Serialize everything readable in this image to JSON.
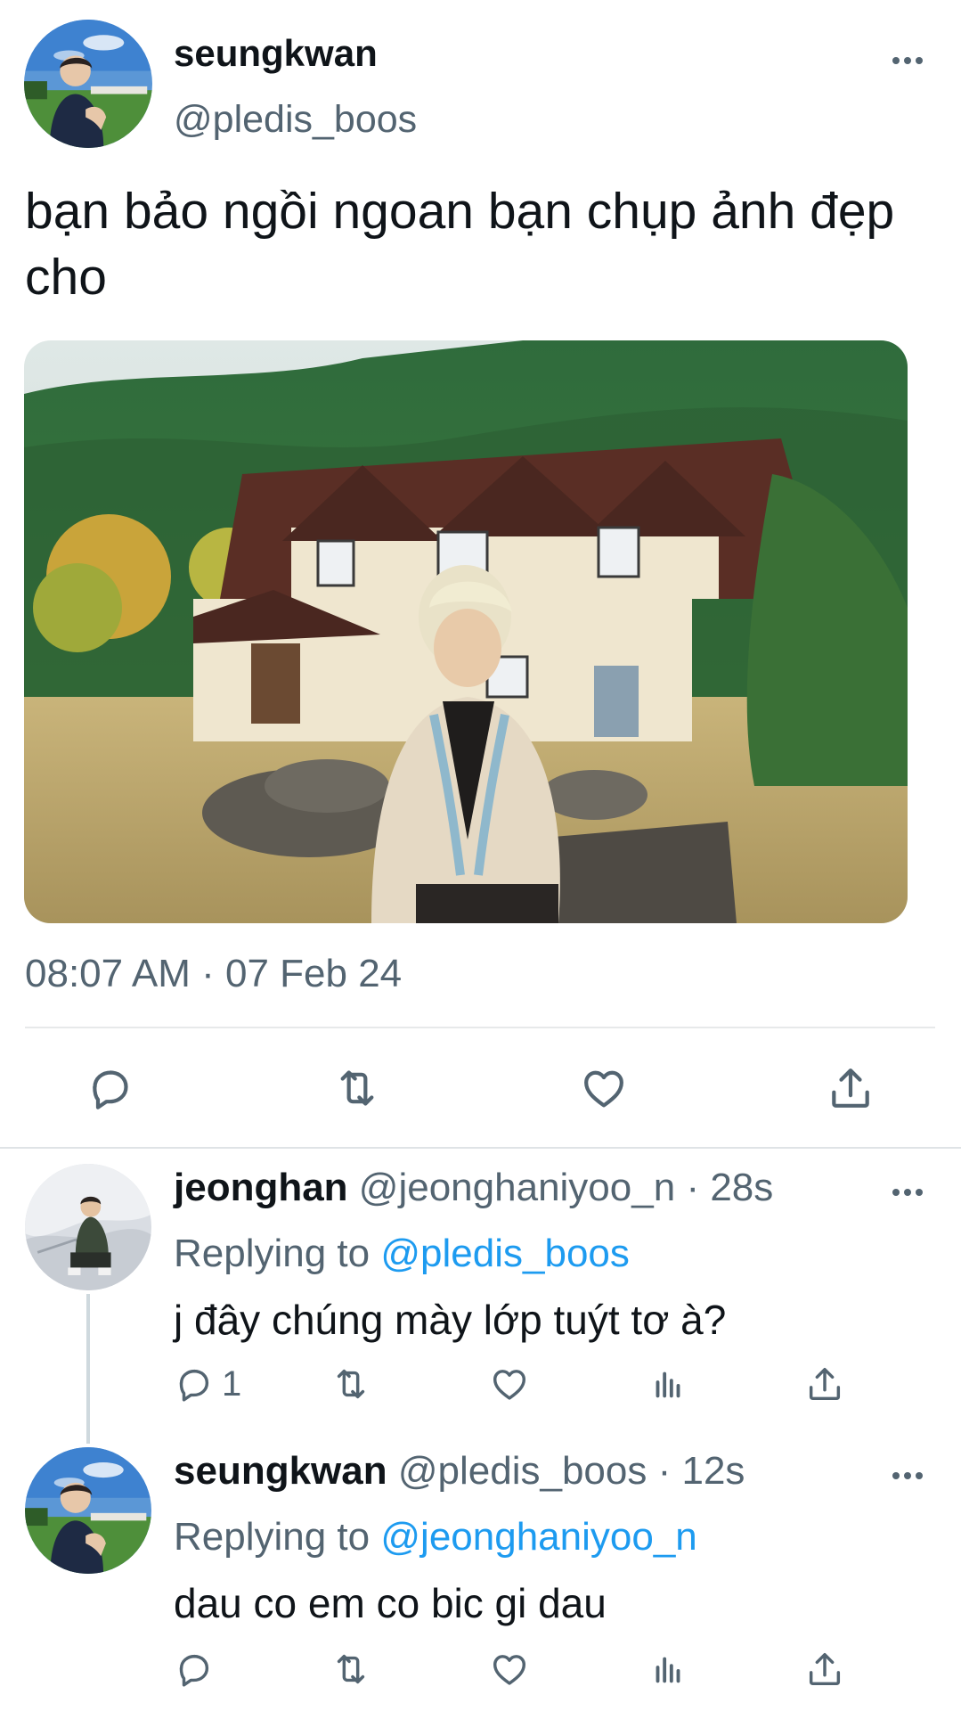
{
  "main_tweet": {
    "display_name": "seungkwan",
    "handle": "@pledis_boos",
    "text": "bạn bảo ngồi ngoan bạn chụp ảnh đẹp cho",
    "timestamp": "08:07 AM · 07 Feb 24",
    "actions": [
      "reply-icon",
      "retweet-icon",
      "like-icon",
      "share-icon"
    ],
    "more_icon": "more-icon"
  },
  "replies": [
    {
      "display_name": "jeonghan",
      "handle": "@jeonghaniyoo_n",
      "time": "· 28s",
      "replying_label": "Replying to",
      "replying_to": "@pledis_boos",
      "text": "j đây chúng mày lớp tuýt tơ à?",
      "reply_count": "1",
      "actions": [
        "reply-icon",
        "retweet-icon",
        "like-icon",
        "analytics-icon",
        "share-icon"
      ]
    },
    {
      "display_name": "seungkwan",
      "handle": "@pledis_boos",
      "time": "· 12s",
      "replying_label": "Replying to",
      "replying_to": "@jeonghaniyoo_n",
      "text": "dau co em co bic gi dau",
      "reply_count": "",
      "actions": [
        "reply-icon",
        "retweet-icon",
        "like-icon",
        "analytics-icon",
        "share-icon"
      ]
    }
  ],
  "colors": {
    "text": "#0f1419",
    "secondary": "#536471",
    "link": "#1d9bf0",
    "divider": "#e7e9ea"
  }
}
